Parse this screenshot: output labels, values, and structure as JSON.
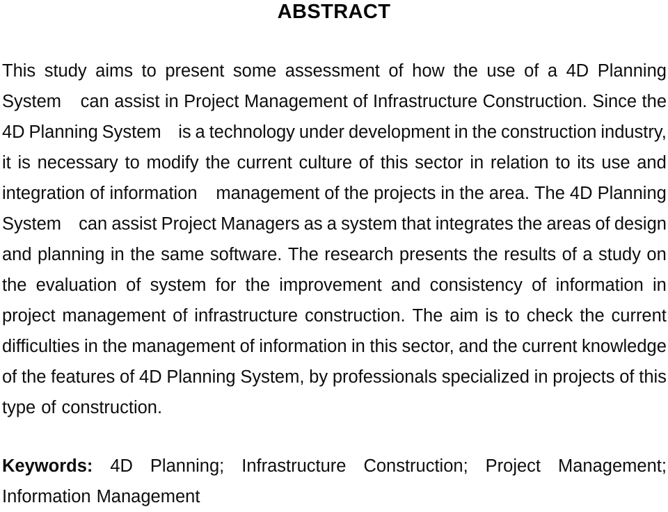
{
  "document": {
    "heading": "ABSTRACT",
    "abstract_lines": [
      [
        "This",
        "study",
        "aims",
        "to",
        "present",
        "some",
        "assessment",
        "of",
        "how",
        "the",
        "use",
        "of",
        "a",
        "4D",
        "Planning"
      ],
      [
        "System",
        "",
        "can",
        "assist",
        "in",
        "Project",
        "Management",
        "of",
        "Infrastructure",
        "Construction.",
        "Since",
        "the"
      ],
      [
        "4D",
        "Planning",
        "System",
        "",
        "is",
        "a",
        "technology",
        "under",
        "development",
        "in",
        "the",
        "construction",
        "industry,"
      ],
      [
        "it",
        "is",
        "necessary",
        "to",
        "modify",
        "the",
        "current",
        "culture",
        "of",
        "this",
        "sector",
        "in",
        "relation",
        "to",
        "its",
        "use",
        "and"
      ],
      [
        "integration",
        "of",
        "information",
        "",
        "management",
        "of",
        "the",
        "projects",
        "in",
        "the",
        "area.",
        "The",
        "4D",
        "Planning"
      ],
      [
        "System",
        "",
        "can",
        "assist",
        "Project",
        "Managers",
        "as",
        "a",
        "system",
        "that",
        "integrates",
        "the",
        "areas",
        "of",
        "design"
      ],
      [
        "and",
        "planning",
        "in",
        "the",
        "same",
        "software.",
        "The",
        "research",
        "presents",
        "the",
        "results",
        "of",
        "a",
        "study",
        "on"
      ],
      [
        "the",
        "evaluation",
        "of",
        "system",
        "for",
        "the",
        "improvement",
        "and",
        "consistency",
        "of",
        "information",
        "in"
      ],
      [
        "project",
        "management",
        "of",
        "infrastructure",
        "construction.",
        "The",
        "aim",
        "is",
        "to",
        "check",
        "the",
        "current"
      ],
      [
        "difficulties",
        "in",
        "the",
        "management",
        "of",
        "information",
        "in",
        "this",
        "sector,",
        "and",
        "the",
        "current",
        "knowledge"
      ],
      [
        "of",
        "the",
        "features",
        "of",
        "4D",
        "Planning",
        "System,",
        "by",
        "professionals",
        "specialized",
        "in",
        "projects",
        "of",
        "this"
      ],
      [
        "type",
        "of",
        "construction."
      ]
    ],
    "abstract_text": "This study aims to present some assessment of how the use of a 4D Planning System  can assist in Project Management of Infrastructure Construction. Since the 4D Planning System  is a technology under development in the construction industry, it is necessary to modify the current culture of this sector in relation to its use and integration of information  management of the projects in the area. The 4D Planning System  can assist Project Managers as a system that integrates the areas of design and planning in the same software. The research presents the results of a study on the evaluation of system for the improvement and consistency of information in project management of infrastructure construction. The aim is to check the current difficulties in the management of information in this sector, and the current knowledge of the features of 4D Planning System, by professionals specialized in projects of this type of construction.",
    "keywords_label": "Keywords:",
    "keywords_lines": [
      [
        "4D",
        "Planning;",
        "Infrastructure",
        "Construction;",
        "Project",
        "Management;"
      ],
      [
        "Information",
        "Management"
      ]
    ],
    "keywords_text": "4D Planning; Infrastructure Construction; Project Management; Information Management",
    "keywords_list": [
      "4D Planning",
      "Infrastructure Construction",
      "Project Management",
      "Information Management"
    ]
  },
  "colors": {
    "page_background": "#ffffff",
    "text": "#0d0d0d",
    "heading": "#050505"
  }
}
